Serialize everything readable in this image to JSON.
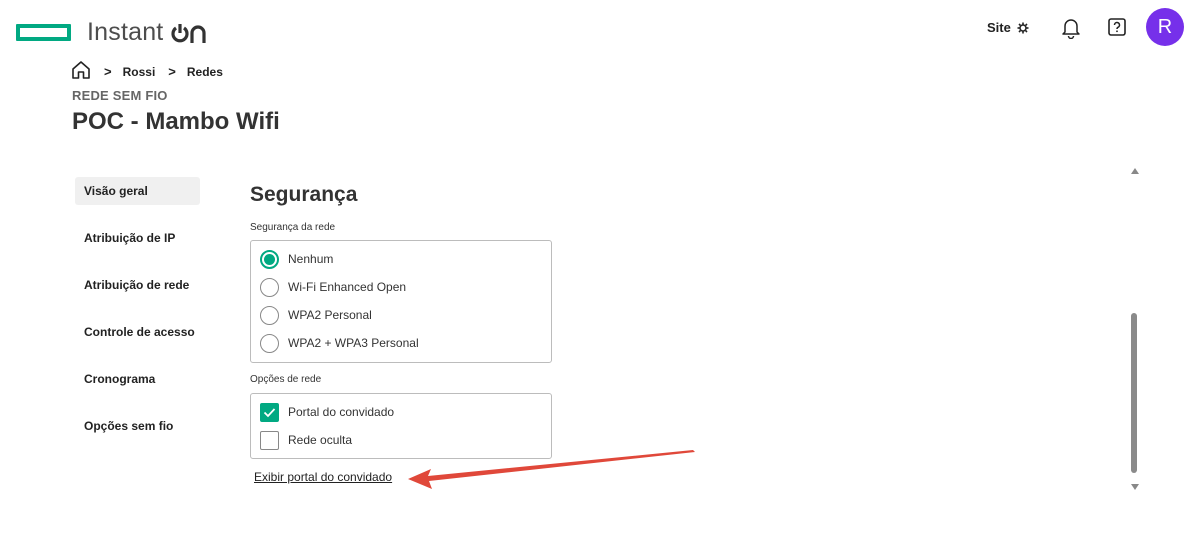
{
  "app": {
    "name": "Instant",
    "name_suffix": "on",
    "brand_color": "#01a982",
    "avatar_color": "#7630ea"
  },
  "topbar": {
    "site_label": "Site",
    "avatar_initial": "R"
  },
  "breadcrumb": {
    "items": [
      "Rossi",
      "Redes"
    ]
  },
  "header": {
    "eyebrow": "REDE SEM FIO",
    "title": "POC - Mambo Wifi"
  },
  "sidebar": {
    "items": [
      {
        "label": "Visão geral",
        "active": true
      },
      {
        "label": "Atribuição de IP",
        "active": false
      },
      {
        "label": "Atribuição de rede",
        "active": false
      },
      {
        "label": "Controle de acesso",
        "active": false
      },
      {
        "label": "Cronograma",
        "active": false
      },
      {
        "label": "Opções sem fio",
        "active": false
      }
    ]
  },
  "security": {
    "title": "Segurança",
    "network_security_label": "Segurança da rede",
    "options": [
      {
        "label": "Nenhum",
        "selected": true
      },
      {
        "label": "Wi-Fi Enhanced Open",
        "selected": false
      },
      {
        "label": "WPA2 Personal",
        "selected": false
      },
      {
        "label": "WPA2 + WPA3 Personal",
        "selected": false
      }
    ],
    "network_options_label": "Opções de rede",
    "network_options": [
      {
        "label": "Portal do convidado",
        "checked": true
      },
      {
        "label": "Rede oculta",
        "checked": false
      }
    ],
    "guest_portal_link": "Exibir portal do convidado"
  },
  "annotation": {
    "arrow_color": "#e0483a"
  }
}
